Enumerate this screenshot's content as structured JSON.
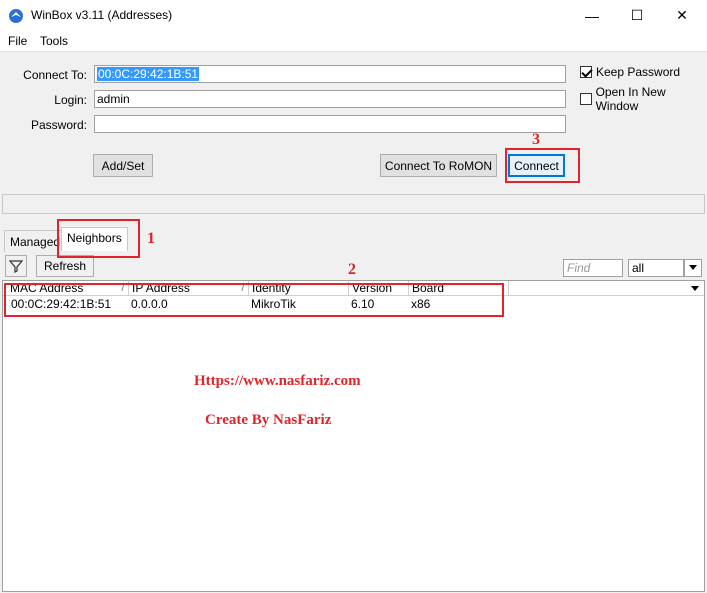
{
  "window": {
    "title": "WinBox v3.11 (Addresses)",
    "minimize_glyph": "—",
    "maximize_glyph": "☐",
    "close_glyph": "✕"
  },
  "menu": [
    "File",
    "Tools"
  ],
  "form": {
    "connect_to_label": "Connect To:",
    "connect_to_value": "00:0C:29:42:1B:51",
    "login_label": "Login:",
    "login_value": "admin",
    "password_label": "Password:",
    "password_value": "",
    "keep_password_label": "Keep Password",
    "keep_password_checked": true,
    "open_new_window_label": "Open In New Window",
    "open_new_window_checked": false
  },
  "buttons": {
    "add_set": "Add/Set",
    "connect_romon": "Connect To RoMON",
    "connect": "Connect"
  },
  "tabs": [
    "Managed",
    "Neighbors"
  ],
  "active_tab": "Neighbors",
  "toolbar": {
    "refresh": "Refresh",
    "find_placeholder": "Find",
    "filter_value": "all"
  },
  "table": {
    "columns": [
      "MAC Address",
      "IP Address",
      "Identity",
      "Version",
      "Board"
    ],
    "rows": [
      [
        "00:0C:29:42:1B:51",
        "0.0.0.0",
        "MikroTik",
        "6.10",
        "x86"
      ]
    ]
  },
  "annotations": {
    "step1": "1",
    "step2": "2",
    "step3": "3",
    "url": "Https://www.nasfariz.com",
    "credit": "Create By NasFariz"
  },
  "colors": {
    "annotation_red": "#e0242a",
    "selection_blue": "#3399ff",
    "focus_blue": "#0078d7"
  }
}
